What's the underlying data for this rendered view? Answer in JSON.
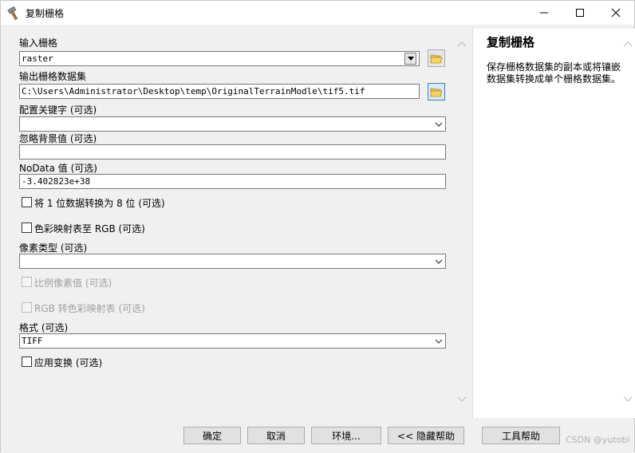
{
  "window": {
    "title": "复制栅格",
    "icon": "hammer-icon",
    "controls": [
      "minimize-icon",
      "maximize-icon",
      "close-icon"
    ]
  },
  "form": {
    "input_raster": {
      "label": "输入栅格",
      "value": "raster"
    },
    "output_dataset": {
      "label": "输出栅格数据集",
      "value": "C:\\Users\\Administrator\\Desktop\\temp\\OriginalTerrainModle\\tif5.tif"
    },
    "config_keyword": {
      "label": "配置关键字 (可选)",
      "value": ""
    },
    "ignore_background": {
      "label": "忽略背景值 (可选)",
      "value": ""
    },
    "nodata": {
      "label": "NoData 值 (可选)",
      "value": "-3.402823e+38"
    },
    "convert_1bit": {
      "label": "将 1 位数据转换为 8 位 (可选)",
      "checked": false
    },
    "colormap_to_rgb": {
      "label": "色彩映射表至 RGB (可选)",
      "checked": false
    },
    "pixel_type": {
      "label": "像素类型 (可选)",
      "value": ""
    },
    "scale_pixel": {
      "label": "比例像素值 (可选)",
      "checked": false,
      "disabled": true
    },
    "rgb_to_colormap": {
      "label": "RGB 转色彩映射表 (可选)",
      "checked": false,
      "disabled": true
    },
    "format": {
      "label": "格式 (可选)",
      "value": "TIFF"
    },
    "apply_transform": {
      "label": "应用变换 (可选)",
      "checked": false
    }
  },
  "help": {
    "title": "复制栅格",
    "text": "保存栅格数据集的副本或将镶嵌数据集转换成单个栅格数据集。"
  },
  "buttons": {
    "ok": "确定",
    "cancel": "取消",
    "environments": "环境...",
    "hide_help": "<< 隐藏帮助",
    "tool_help": "工具帮助"
  },
  "watermark": "CSDN @yutobi",
  "colors": {
    "title_bg": "#ffffff",
    "panel_bg": "#f0f0f0",
    "active_border": "#3c7fb1"
  }
}
